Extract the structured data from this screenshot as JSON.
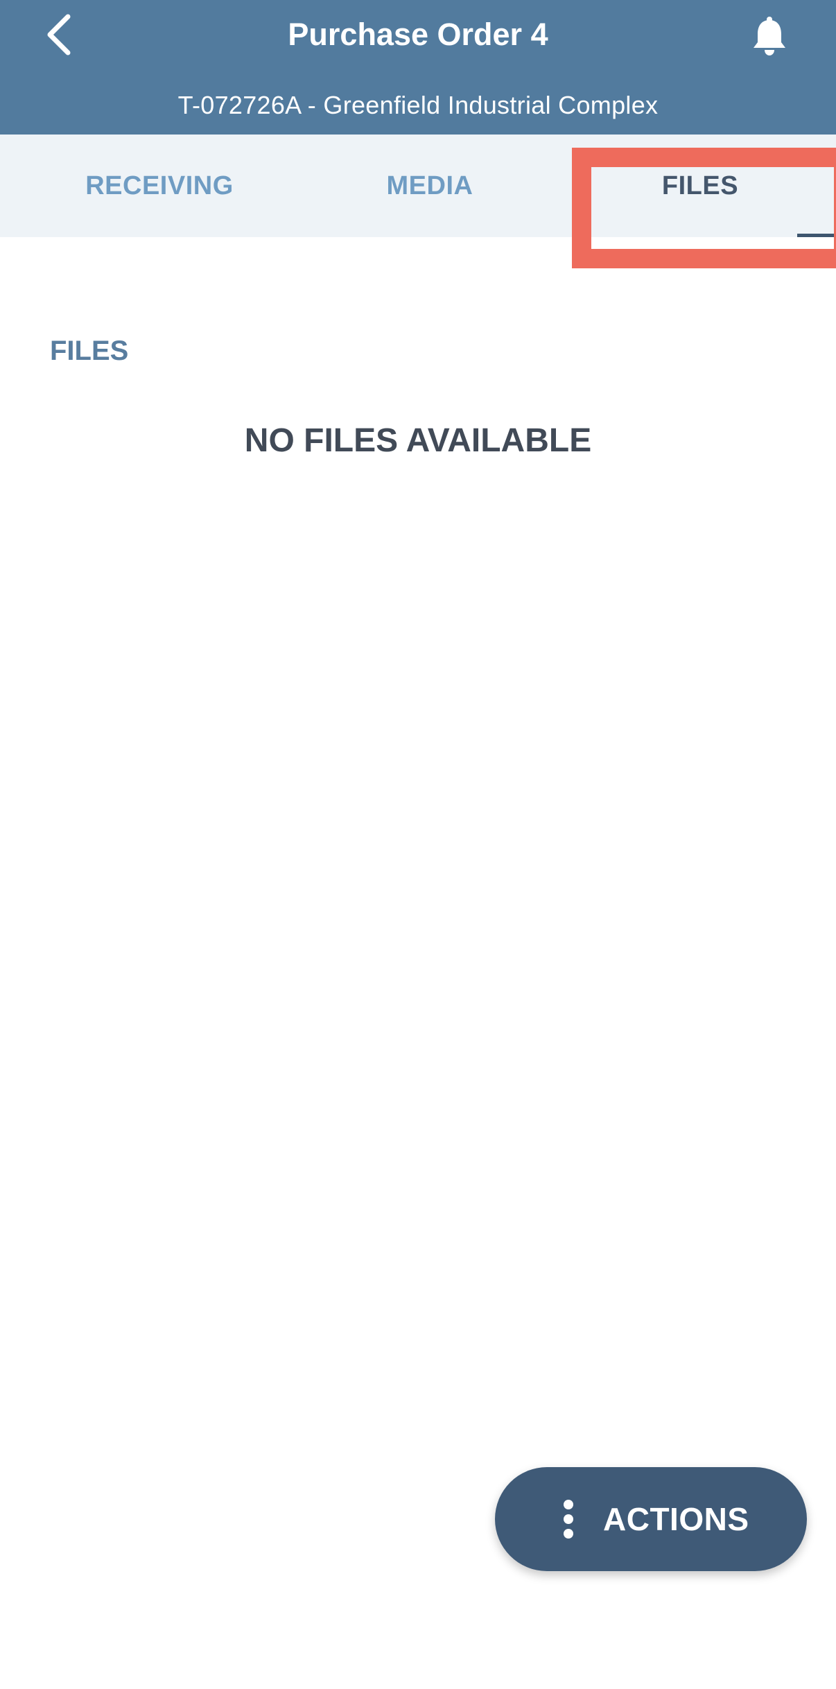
{
  "header": {
    "title": "Purchase Order 4",
    "subtitle": "T-072726A - Greenfield Industrial Complex",
    "back_icon": "chevron-left-icon",
    "bell_icon": "bell-icon",
    "color": "#527b9e"
  },
  "tabs": [
    {
      "label": "RECEIVING",
      "active": false
    },
    {
      "label": "MEDIA",
      "active": false
    },
    {
      "label": "FILES",
      "active": true
    }
  ],
  "main": {
    "section_title": "FILES",
    "empty_message": "NO FILES AVAILABLE"
  },
  "actions": {
    "label": "ACTIONS",
    "icon": "more-vertical-icon",
    "color": "#3f5a77"
  },
  "highlight": {
    "target": "tab-files",
    "color": "#ee6b5c"
  }
}
